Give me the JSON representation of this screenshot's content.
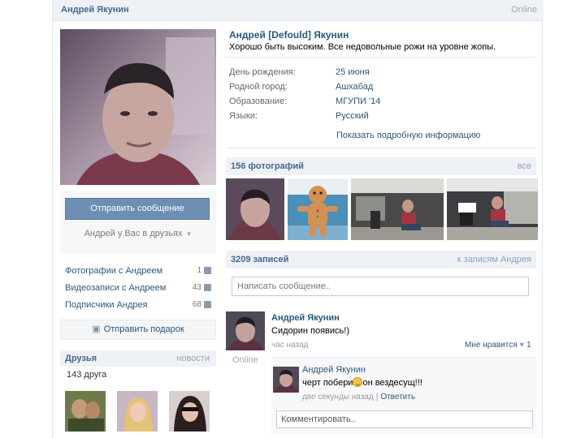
{
  "top_bar": {
    "name": "Андрей Якунин",
    "online": "Online"
  },
  "left": {
    "send_message": "Отправить сообщение",
    "friend_status": "Андрей у Вас в друзьях",
    "counters": [
      {
        "label": "Фотографии с Андреем",
        "count": "1",
        "icon": "camera-icon"
      },
      {
        "label": "Видеозаписи с Андреем",
        "count": "43",
        "icon": "film-icon"
      },
      {
        "label": "Подписчики Андрея",
        "count": "68",
        "icon": "people-icon"
      }
    ],
    "gift": "Отправить подарок",
    "friends": {
      "title": "Друзья",
      "news": "новости",
      "count": "143 друга"
    }
  },
  "profile": {
    "name": "Андрей [Defould] Якунин",
    "status": "Хорошо быть высоким. Все недовольные рожи на уровне жопы.",
    "info": [
      {
        "key": "День рождения:",
        "value": "25 июня"
      },
      {
        "key": "Родной город:",
        "value": "Ашхабад"
      },
      {
        "key": "Образование:",
        "value": "МГУПИ '14"
      },
      {
        "key": "Языки:",
        "value": "Русский"
      }
    ],
    "more": "Показать подробную информацию"
  },
  "photos": {
    "title": "156 фотографий",
    "all": "все"
  },
  "wall": {
    "title": "3209 записей",
    "link": "к записям Андрея",
    "placeholder": "Написать сообщение.."
  },
  "post": {
    "author": "Андрей Якунин",
    "online": "Online",
    "text": "Сидорин появись!)",
    "time": "час назад",
    "like": "Мне нравится",
    "like_count": "1"
  },
  "comment": {
    "author": "Андрей Якунин",
    "text_before": "черт побери",
    "text_after": "он вездесущ!!!",
    "time": "две секунды назад",
    "reply": "Ответить",
    "input_placeholder": "Комментировать.."
  },
  "colors": {
    "link": "#2b587a",
    "header_bg": "#eef1f5",
    "button": "#6d8fb3"
  }
}
